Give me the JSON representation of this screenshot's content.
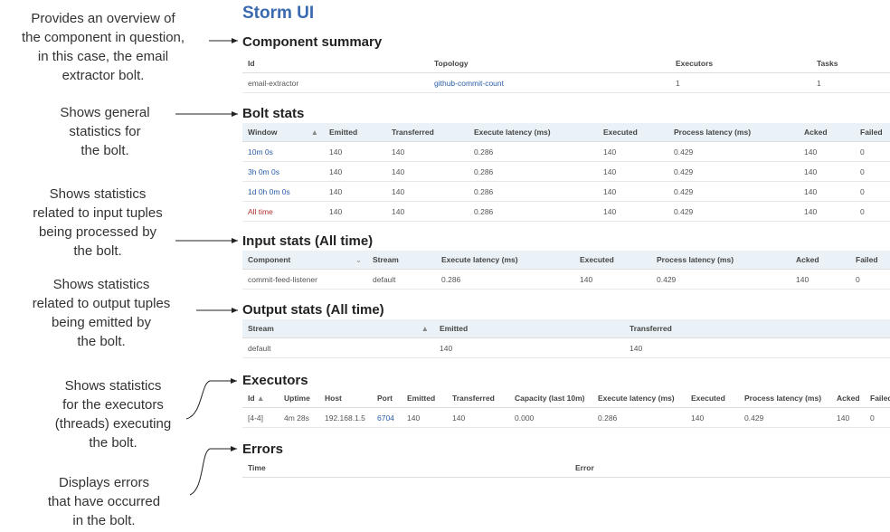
{
  "app": {
    "title": "Storm UI"
  },
  "annotations": {
    "summary": [
      "Provides an overview of",
      "the component in question,",
      "in this case, the email",
      "extractor bolt."
    ],
    "bolt_stats": [
      "Shows general",
      "statistics for",
      "the bolt."
    ],
    "input_stats": [
      "Shows statistics",
      "related to input tuples",
      "being processed by",
      "the bolt."
    ],
    "output_stats": [
      "Shows statistics",
      "related to output tuples",
      "being emitted by",
      "the bolt."
    ],
    "executors": [
      "Shows statistics",
      "for the executors",
      "(threads) executing",
      "the bolt."
    ],
    "errors": [
      "Displays errors",
      "that have occurred",
      "in the bolt."
    ]
  },
  "component_summary": {
    "title": "Component summary",
    "headers": [
      "Id",
      "Topology",
      "Executors",
      "Tasks"
    ],
    "row": [
      "email-extractor",
      "github-commit-count",
      "1",
      "1"
    ]
  },
  "bolt_stats": {
    "title": "Bolt stats",
    "headers": [
      "Window",
      "Emitted",
      "Transferred",
      "Execute latency (ms)",
      "Executed",
      "Process latency (ms)",
      "Acked",
      "Failed"
    ],
    "sort_icon": "▲",
    "rows": [
      [
        "10m 0s",
        "140",
        "140",
        "0.286",
        "140",
        "0.429",
        "140",
        "0"
      ],
      [
        "3h 0m 0s",
        "140",
        "140",
        "0.286",
        "140",
        "0.429",
        "140",
        "0"
      ],
      [
        "1d 0h 0m 0s",
        "140",
        "140",
        "0.286",
        "140",
        "0.429",
        "140",
        "0"
      ],
      [
        "All time",
        "140",
        "140",
        "0.286",
        "140",
        "0.429",
        "140",
        "0"
      ]
    ]
  },
  "input_stats": {
    "title": "Input stats (All time)",
    "headers": [
      "Component",
      "Stream",
      "Execute latency (ms)",
      "Executed",
      "Process latency (ms)",
      "Acked",
      "Failed"
    ],
    "sort_icon": "⌄",
    "row": [
      "commit-feed-listener",
      "default",
      "0.286",
      "140",
      "0.429",
      "140",
      "0"
    ]
  },
  "output_stats": {
    "title": "Output stats (All time)",
    "headers": [
      "Stream",
      "Emitted",
      "Transferred"
    ],
    "sort_icon": "▲",
    "row": [
      "default",
      "140",
      "140"
    ]
  },
  "executors": {
    "title": "Executors",
    "headers": [
      "Id",
      "Uptime",
      "Host",
      "Port",
      "Emitted",
      "Transferred",
      "Capacity (last 10m)",
      "Execute latency (ms)",
      "Executed",
      "Process latency (ms)",
      "Acked",
      "Failed"
    ],
    "sort_icon": "▲",
    "row": [
      "[4-4]",
      "4m 28s",
      "192.168.1.5",
      "6704",
      "140",
      "140",
      "0.000",
      "0.286",
      "140",
      "0.429",
      "140",
      "0"
    ]
  },
  "errors": {
    "title": "Errors",
    "headers": [
      "Time",
      "Error"
    ]
  },
  "colors": {
    "accent": "#3a6ab0",
    "link": "#2a5ea8",
    "header_shade": "#eaf2f7"
  }
}
